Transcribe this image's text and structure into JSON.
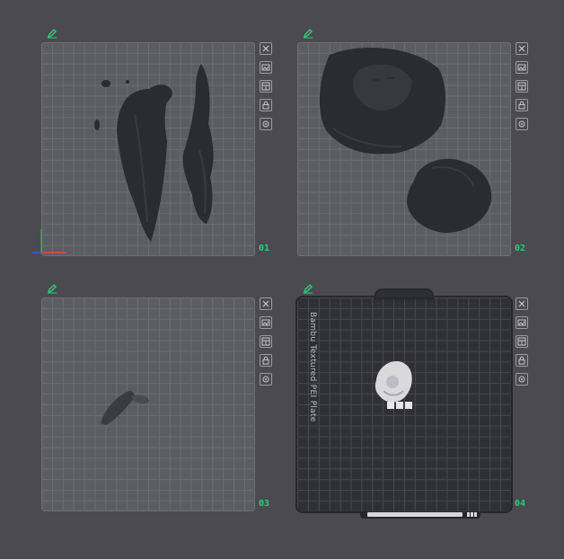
{
  "plates": [
    {
      "id": "plate-1",
      "number": "01"
    },
    {
      "id": "plate-2",
      "number": "02"
    },
    {
      "id": "plate-3",
      "number": "03"
    },
    {
      "id": "plate-4",
      "number": "04",
      "label": "Bambu Textured PEI Plate"
    }
  ],
  "toolbar_icons": [
    "close-icon",
    "arrange-icon",
    "orient-icon",
    "lock-icon",
    "settings-icon"
  ],
  "colors": {
    "accent": "#2ecc71",
    "model_dark": "#2b2c2f",
    "model_light": "#d9d9dc"
  }
}
